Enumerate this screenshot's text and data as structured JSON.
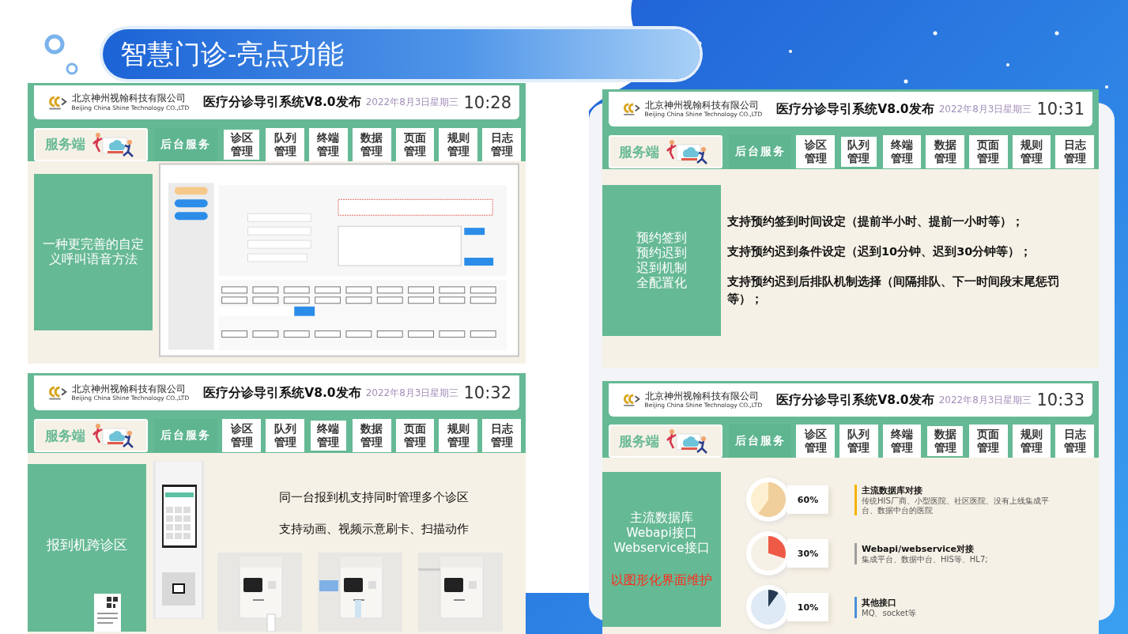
{
  "slide": {
    "title": "智慧门诊-亮点功能"
  },
  "panels": [
    {
      "header": {
        "company": "北京神州视翰科技有限公司",
        "company_en": "Beijing China Shine Technology CO.,LTD",
        "title": "医疗分诊导引系统V8.0发布",
        "date": "2022年8月3日星期三",
        "time": "10:28"
      },
      "nav": {
        "service": "服务端",
        "backend": "后台服务",
        "tabs": [
          {
            "label": "诊区管理",
            "selected": true
          },
          {
            "label": "队列管理",
            "selected": false
          },
          {
            "label": "终端管理",
            "selected": false
          },
          {
            "label": "数据管理",
            "selected": false
          },
          {
            "label": "页面管理",
            "selected": false
          },
          {
            "label": "规则管理",
            "selected": false
          },
          {
            "label": "日志管理",
            "selected": false
          }
        ]
      },
      "side": {
        "lines": [
          "一种更完善的自定义呼叫语音方法"
        ]
      },
      "content": {
        "kind": "dialog"
      }
    },
    {
      "header": {
        "company": "北京神州视翰科技有限公司",
        "company_en": "Beijing China Shine Technology CO.,LTD",
        "title": "医疗分诊导引系统V8.0发布",
        "date": "2022年8月3日星期三",
        "time": "10:31"
      },
      "nav": {
        "service": "服务端",
        "backend": "后台服务",
        "tabs": [
          {
            "label": "诊区管理",
            "selected": false
          },
          {
            "label": "队列管理",
            "selected": true
          },
          {
            "label": "终端管理",
            "selected": false
          },
          {
            "label": "数据管理",
            "selected": false
          },
          {
            "label": "页面管理",
            "selected": false
          },
          {
            "label": "规则管理",
            "selected": false
          },
          {
            "label": "日志管理",
            "selected": false
          }
        ]
      },
      "side": {
        "lines": [
          "预约签到",
          "预约迟到",
          "迟到机制",
          "全配置化"
        ]
      },
      "content": {
        "kind": "bullets",
        "items": [
          "支持预约签到时间设定（提前半小时、提前一小时等）；",
          "支持预约迟到条件设定（迟到10分钟、迟到30分钟等）；",
          "支持预约迟到后排队机制选择（间隔排队、下一时间段末尾惩罚等）；"
        ]
      }
    },
    {
      "header": {
        "company": "北京神州视翰科技有限公司",
        "company_en": "Beijing China Shine Technology CO.,LTD",
        "title": "医疗分诊导引系统V8.0发布",
        "date": "2022年8月3日星期三",
        "time": "10:32"
      },
      "nav": {
        "service": "服务端",
        "backend": "后台服务",
        "tabs": [
          {
            "label": "诊区管理",
            "selected": false
          },
          {
            "label": "队列管理",
            "selected": false
          },
          {
            "label": "终端管理",
            "selected": true
          },
          {
            "label": "数据管理",
            "selected": false
          },
          {
            "label": "页面管理",
            "selected": false
          },
          {
            "label": "规则管理",
            "selected": false
          },
          {
            "label": "日志管理",
            "selected": false
          }
        ]
      },
      "side": {
        "lines": [
          "报到机跨诊区"
        ]
      },
      "content": {
        "kind": "terminal",
        "captions": [
          "同一台报到机支持同时管理多个诊区",
          "支持动画、视频示意刷卡、扫描动作"
        ]
      }
    },
    {
      "header": {
        "company": "北京神州视翰科技有限公司",
        "company_en": "Beijing China Shine Technology CO.,LTD",
        "title": "医疗分诊导引系统V8.0发布",
        "date": "2022年8月3日星期三",
        "time": "10:33"
      },
      "nav": {
        "service": "服务端",
        "backend": "后台服务",
        "tabs": [
          {
            "label": "诊区管理",
            "selected": false
          },
          {
            "label": "队列管理",
            "selected": false
          },
          {
            "label": "终端管理",
            "selected": false
          },
          {
            "label": "数据管理",
            "selected": true
          },
          {
            "label": "页面管理",
            "selected": false
          },
          {
            "label": "规则管理",
            "selected": false
          },
          {
            "label": "日志管理",
            "selected": false
          }
        ]
      },
      "side": {
        "lines": [
          "主流数据库",
          "Webapi接口",
          "Webservice接口"
        ],
        "note": "以图形化界面维护"
      },
      "content": {
        "kind": "stats",
        "items": [
          {
            "chart_data": {
              "type": "pie",
              "values": [
                60,
                40
              ]
            },
            "percent": "60%",
            "title": "主流数据库对接",
            "desc": "传统HIS厂商、小型医院、社区医院、没有上线集成平台、数据中台的医院",
            "color": "#f5b400"
          },
          {
            "chart_data": {
              "type": "pie",
              "values": [
                30,
                70
              ]
            },
            "percent": "30%",
            "title": "Webapi/webservice对接",
            "desc": "集成平台、数据中台、HIS等、HL7;",
            "color": "#9e9e9e"
          },
          {
            "chart_data": {
              "type": "pie",
              "values": [
                10,
                90
              ]
            },
            "percent": "10%",
            "title": "其他接口",
            "desc": "MQ、socket等",
            "color": "#4a90d9"
          }
        ]
      }
    }
  ]
}
